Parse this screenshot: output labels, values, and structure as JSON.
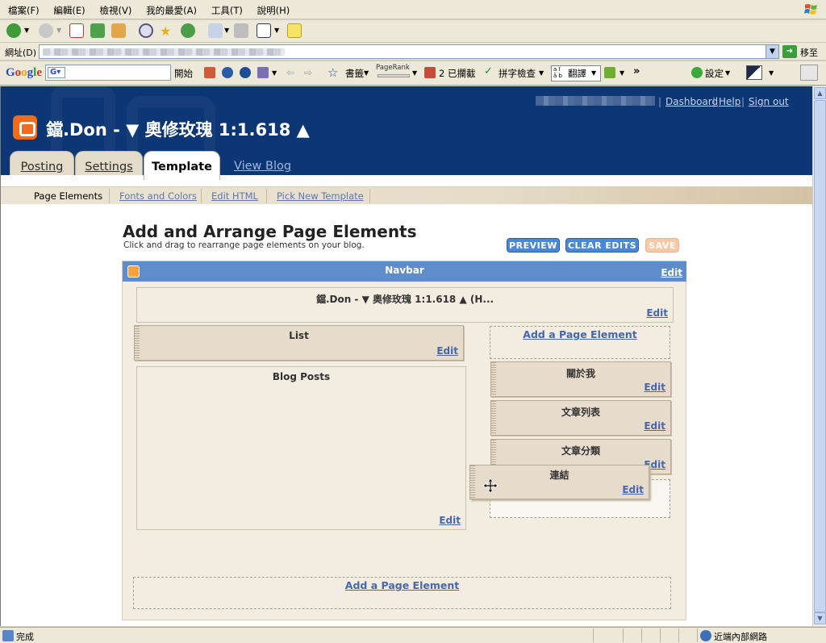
{
  "browser": {
    "menu": [
      "檔案(F)",
      "編輯(E)",
      "檢視(V)",
      "我的最愛(A)",
      "工具(T)",
      "說明(H)"
    ],
    "address_label": "網址(D)",
    "go_label": "移至",
    "google": {
      "search_label": "開始",
      "bookmarks_label": "書籤",
      "pagerank_label": "PageRank",
      "blocked_label": "2 已攔截",
      "spellcheck_label": "拼字檢查",
      "translate_label": "翻譯",
      "settings_label": "設定"
    },
    "status_text": "完成",
    "zone_text": "近端內部網路"
  },
  "blogger": {
    "blog_title": "鐺.Don - ▼ 奧修玫瑰 1:1.618 ▲",
    "top_links": [
      "Dashboard",
      "Help",
      "Sign out"
    ],
    "tabs": [
      "Posting",
      "Settings",
      "Template"
    ],
    "active_tab": "Template",
    "view_blog": "View Blog",
    "subnav": [
      "Page Elements",
      "Fonts and Colors",
      "Edit HTML",
      "Pick New Template"
    ],
    "heading": "Add and Arrange Page Elements",
    "subheading": "Click and drag to rearrange page elements on your blog.",
    "buttons": {
      "preview": "PREVIEW",
      "clear": "CLEAR EDITS",
      "save": "SAVE"
    }
  },
  "layout": {
    "navbar_title": "Navbar",
    "edit_label": "Edit",
    "header_widget": "鐺.Don - ▼ 奧修玫瑰 1:1.618 ▲ (H...",
    "list_widget": "List",
    "blog_posts": "Blog Posts",
    "add_element": "Add a Page Element",
    "sidebar_widgets": [
      "關於我",
      "文章列表",
      "文章分類"
    ],
    "dragged_widget": "連結"
  },
  "colors": {
    "header_bg": "#0c3774",
    "navbar_bg": "#5f8cca",
    "layout_bg": "#f3ece1",
    "widget_bg": "#e7dccb",
    "link": "#4666b0",
    "blogger_orange": "#f26a1b"
  }
}
